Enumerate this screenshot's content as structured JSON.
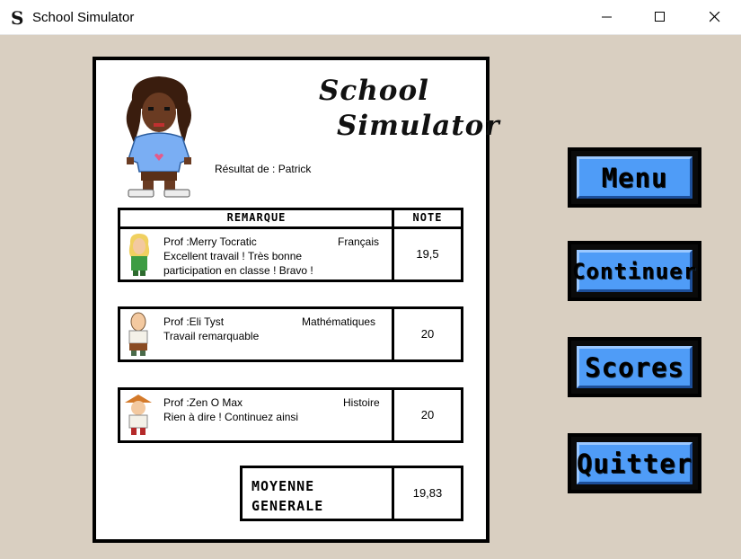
{
  "window": {
    "title": "School Simulator",
    "icon_glyph": "S"
  },
  "logo": {
    "line1": "School",
    "line2": "Simulator"
  },
  "result_label": "Résultat de : Patrick",
  "table": {
    "header_remark": "REMARQUE",
    "header_grade": "NOTE",
    "rows": [
      {
        "teacher": "Prof :Merry Tocratic",
        "subject": "Français",
        "comment": "Excellent travail ! Très bonne",
        "comment2": "participation en classe ! Bravo !",
        "grade": "19,5",
        "avatar": "blonde-teacher-icon"
      },
      {
        "teacher": "Prof :Eli Tyst",
        "subject": "Mathématiques",
        "comment": "Travail remarquable",
        "comment2": "",
        "grade": "20",
        "avatar": "bald-teacher-icon"
      },
      {
        "teacher": "Prof :Zen O Max",
        "subject": "Histoire",
        "comment": "Rien à dire ! Continuez ainsi",
        "comment2": "",
        "grade": "20",
        "avatar": "hat-teacher-icon"
      }
    ]
  },
  "average": {
    "label_line1": "MOYENNE",
    "label_line2": "GENERALE",
    "value": "19,83"
  },
  "buttons": {
    "menu": "Menu",
    "continue": "Continuer",
    "scores": "Scores",
    "quit": "Quitter"
  },
  "colors": {
    "button_face": "#4f9cf7",
    "background": "#d9cfc1"
  }
}
